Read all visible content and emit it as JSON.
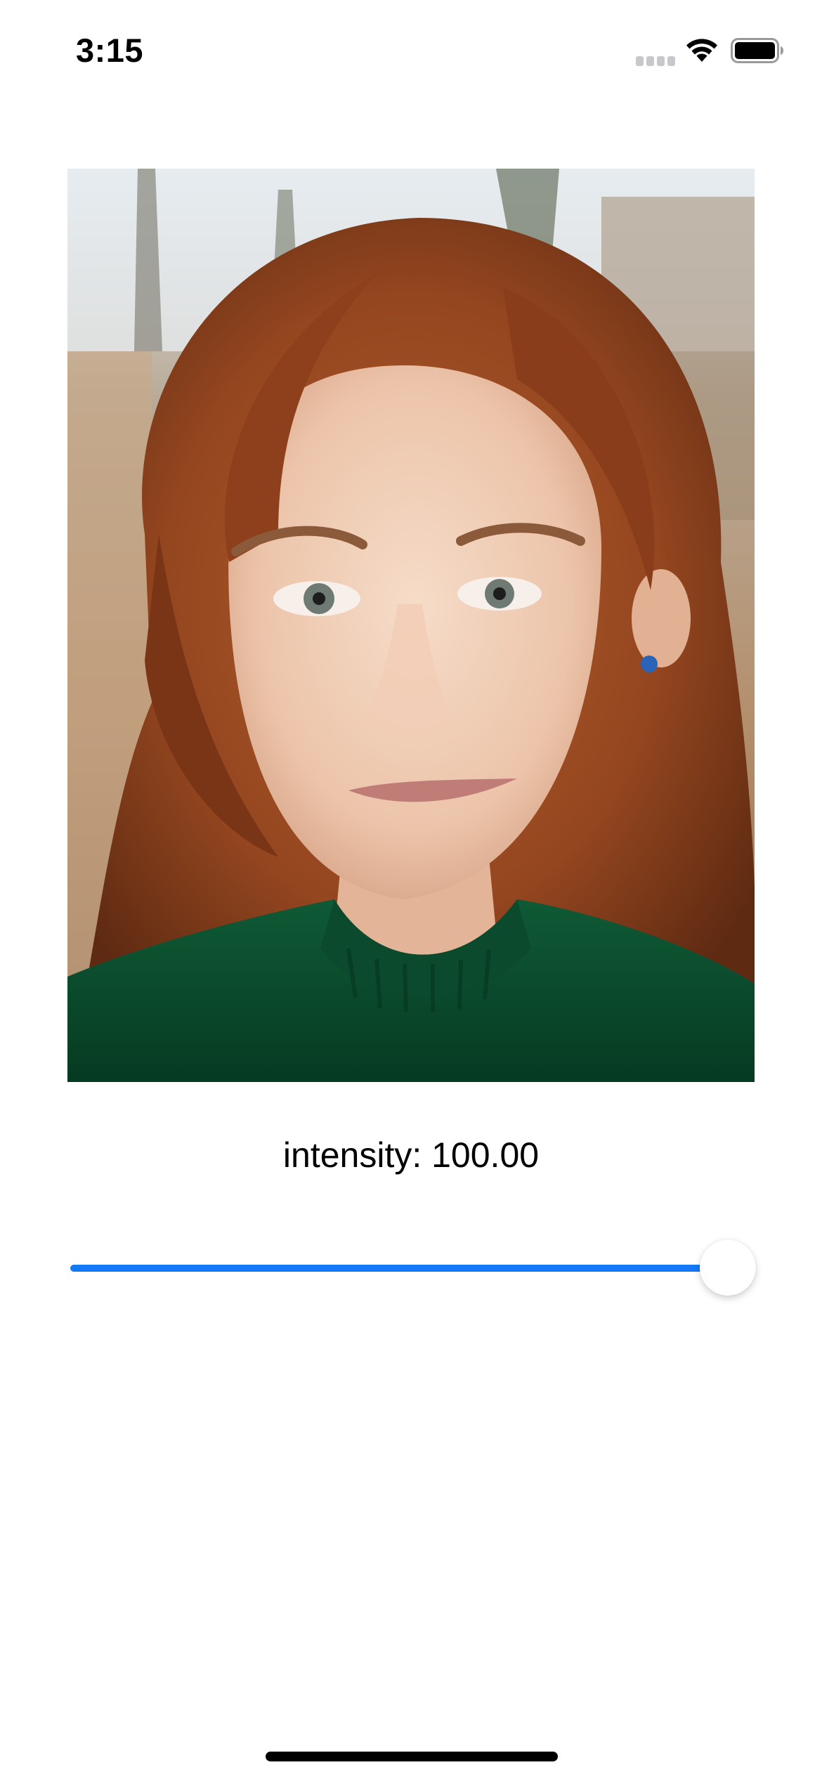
{
  "status_bar": {
    "time": "3:15",
    "icons": [
      "cellular-signal-icon",
      "wifi-icon",
      "battery-icon"
    ]
  },
  "photo": {
    "subject": "portrait-photo"
  },
  "intensity": {
    "label": "intensity: 100.00",
    "value": 100.0,
    "min": 0,
    "max": 100
  },
  "colors": {
    "accent": "#1479f6",
    "track": "#e3e3e8",
    "background": "#ffffff"
  }
}
